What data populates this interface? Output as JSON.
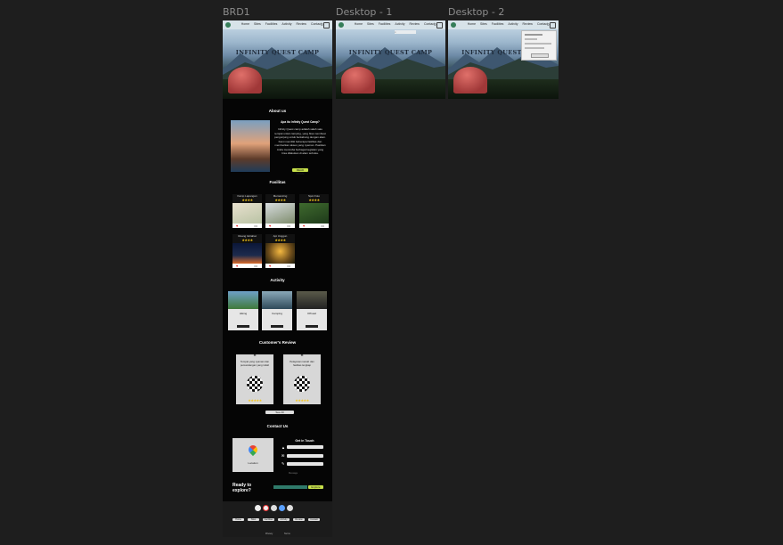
{
  "frames": [
    {
      "label": "BRD1"
    },
    {
      "label": "Desktop - 1"
    },
    {
      "label": "Desktop - 2"
    }
  ],
  "hero": {
    "title": "INFINITY QUEST CAMP",
    "nav_links": [
      "Home",
      "Sites",
      "Facilities",
      "Activity",
      "Review",
      "Contact"
    ]
  },
  "about": {
    "title": "About us",
    "heading": "Apa itu Infinity Quest Camp?",
    "body": "Infinity Quest camp adalah salah satu tempat untuk camping, yang bisa membuat pengunjung untuk berkabung dengan alam. Kami memiliki beberapa fasilitas dan memberikan akses yang nyaman. Pastikan Anda mencoba berbagai kegiatan yang bisa dilakukan di alam terbuka.",
    "button": "READ MORE"
  },
  "facilities": {
    "title": "Fasilitas",
    "items": [
      {
        "name": "Kamp Lapangan",
        "rating": 4
      },
      {
        "name": "Memancing",
        "rating": 4
      },
      {
        "name": "Spot Foto",
        "rating": 4
      },
      {
        "name": "Ruang Istirahat",
        "rating": 4
      },
      {
        "name": "Api Unggun",
        "rating": 4
      }
    ]
  },
  "activity": {
    "title": "Activity",
    "items": [
      {
        "label": "Hiking"
      },
      {
        "label": "Camping"
      },
      {
        "label": "Offroad"
      }
    ]
  },
  "reviews": {
    "title": "Customer's Review",
    "items": [
      {
        "text": "Tempat yang nyaman dan pemandangan yang indah"
      },
      {
        "text": "Pelayanan ramah dan fasilitas lengkap"
      }
    ],
    "more_button": "See All"
  },
  "contact": {
    "title": "Contact Us",
    "map_label": "Location",
    "form_title": "Get in Touch",
    "fields": [
      {
        "placeholder": "Your name"
      },
      {
        "placeholder": "Email"
      },
      {
        "placeholder": "Message"
      }
    ]
  },
  "cta": {
    "text": "Ready to explore?",
    "button": "Explore"
  },
  "footer": {
    "links": [
      "Home",
      "Sites",
      "Facilities",
      "Activity",
      "Review",
      "Contact"
    ],
    "bottom": [
      "Privacy",
      "Terms"
    ]
  },
  "colors": {
    "canvas": "#1e1e1e",
    "page_bg": "#050505",
    "accent": "#c7e04a",
    "star": "#f5c518"
  }
}
